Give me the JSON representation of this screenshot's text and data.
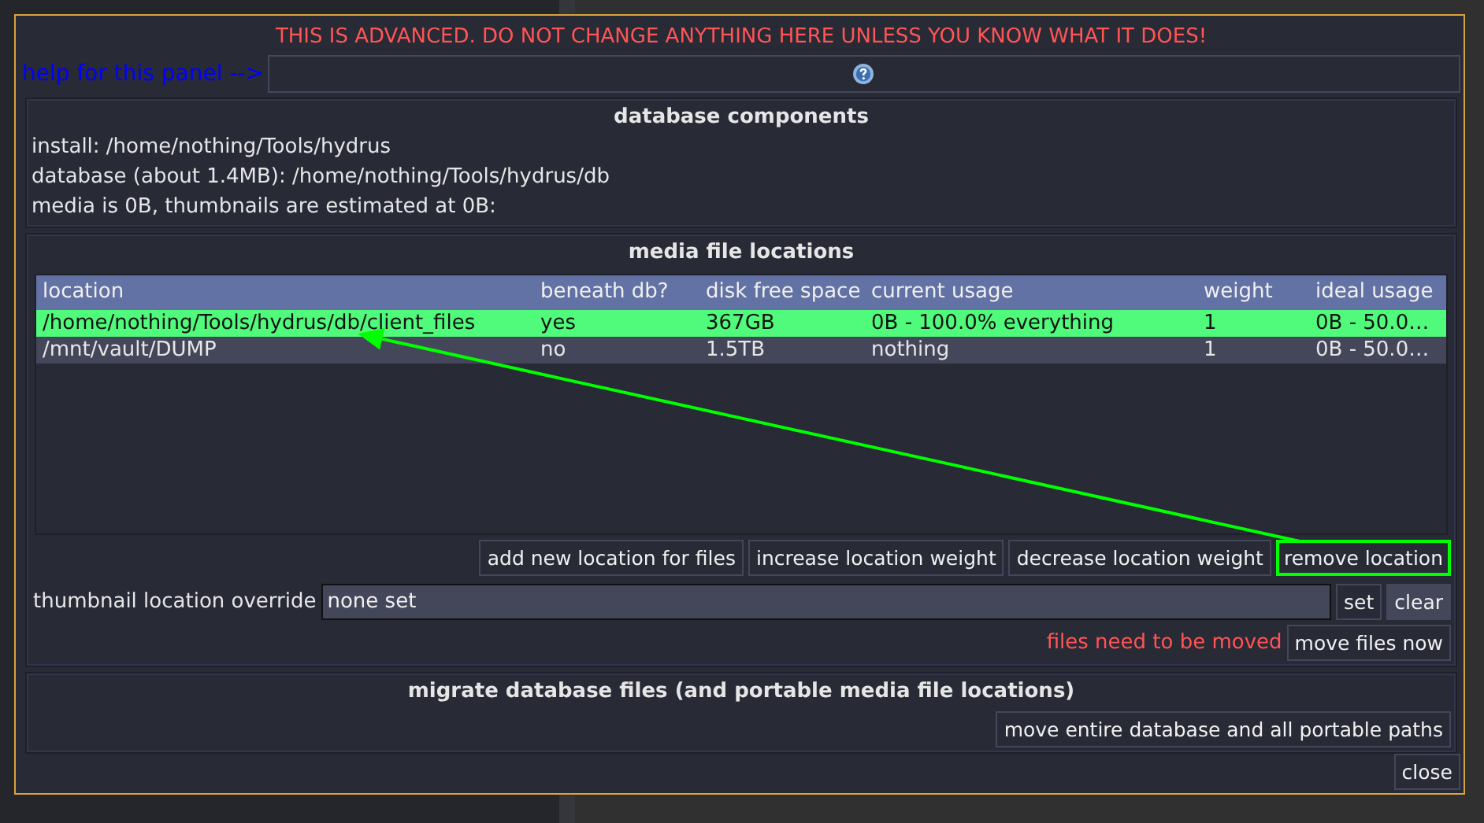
{
  "warning": "THIS IS ADVANCED. DO NOT CHANGE ANYTHING HERE UNLESS YOU KNOW WHAT IT DOES!",
  "help": {
    "label": "help for this panel -->"
  },
  "database_components": {
    "title": "database components",
    "lines": [
      "install: /home/nothing/Tools/hydrus",
      "database (about 1.4MB): /home/nothing/Tools/hydrus/db",
      "media is 0B, thumbnails are estimated at 0B:"
    ]
  },
  "media_file_locations": {
    "title": "media file locations",
    "columns": [
      "location",
      "beneath db?",
      "disk free space",
      "current usage",
      "weight",
      "ideal usage"
    ],
    "rows": [
      {
        "selected": true,
        "cells": [
          "/home/nothing/Tools/hydrus/db/client_files",
          "yes",
          "367GB",
          "0B - 100.0% everything",
          "1",
          "0B - 50.0…"
        ]
      },
      {
        "selected": false,
        "cells": [
          "/mnt/vault/DUMP",
          "no",
          "1.5TB",
          "nothing",
          "1",
          "0B - 50.0…"
        ]
      }
    ],
    "buttons": [
      {
        "label": "add new location for files",
        "highlighted": false
      },
      {
        "label": "increase location weight",
        "highlighted": false
      },
      {
        "label": "decrease location weight",
        "highlighted": false
      },
      {
        "label": "remove location",
        "highlighted": true
      }
    ],
    "thumbnail_override": {
      "label": "thumbnail location override",
      "value": "none set",
      "buttons": [
        "set",
        "clear"
      ]
    },
    "status": "files need to be moved",
    "move_button": "move files now"
  },
  "migrate": {
    "title": "migrate database files (and portable media file locations)",
    "button": "move entire database and all portable paths"
  },
  "close_button": "close",
  "annotation_arrow": {
    "color": "#00ff00"
  }
}
